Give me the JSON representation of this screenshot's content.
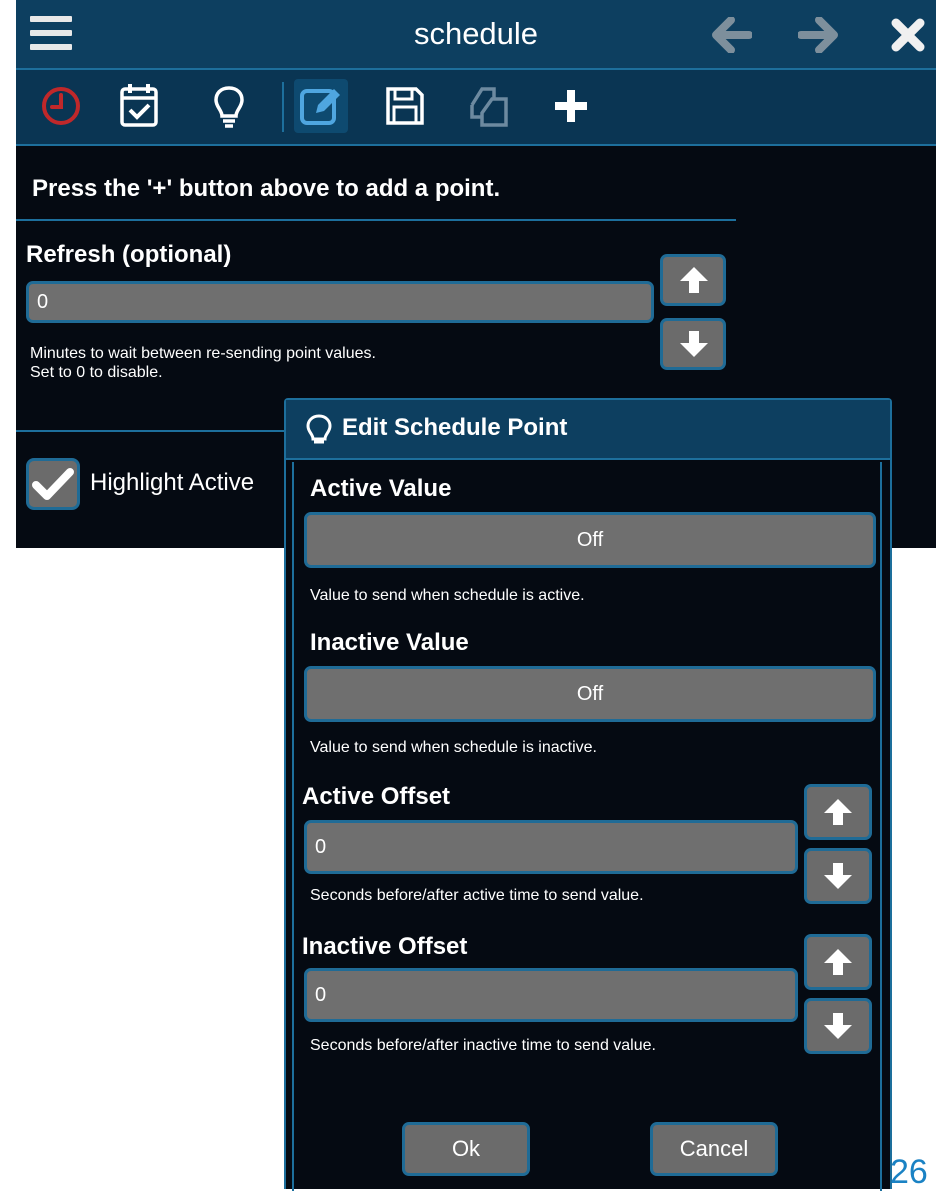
{
  "window": {
    "title": "schedule"
  },
  "toolbar": {
    "tools": [
      {
        "icon": "clock-icon",
        "color": "#c0282a"
      },
      {
        "icon": "calendar-check-icon",
        "color": "#ffffff"
      },
      {
        "icon": "lightbulb-icon",
        "color": "#ffffff"
      },
      {
        "icon": "edit-icon",
        "color": "#4fa6e0",
        "selected": true
      },
      {
        "icon": "save-icon",
        "color": "#ffffff"
      },
      {
        "icon": "copy-icon",
        "color": "#6d8aa0",
        "disabled": true
      },
      {
        "icon": "plus-icon",
        "color": "#ffffff"
      }
    ]
  },
  "main": {
    "hint": "Press the '+' button above to add a point.",
    "refresh": {
      "label": "Refresh (optional)",
      "value": "0",
      "help_line1": "Minutes to wait between re-sending point values.",
      "help_line2": "Set to 0 to disable."
    },
    "highlight": {
      "label": "Highlight Active",
      "checked": true
    }
  },
  "dialog": {
    "title": "Edit Schedule Point",
    "active_value": {
      "label": "Active Value",
      "value": "Off",
      "help": "Value to send when schedule is active."
    },
    "inactive_value": {
      "label": "Inactive Value",
      "value": "Off",
      "help": "Value to send when schedule is inactive."
    },
    "active_offset": {
      "label": "Active Offset",
      "value": "0",
      "help": "Seconds before/after active time to send value."
    },
    "inactive_offset": {
      "label": "Inactive Offset",
      "value": "0",
      "help": "Seconds before/after inactive time to send value."
    },
    "ok_label": "Ok",
    "cancel_label": "Cancel"
  },
  "page_number": "26",
  "colors": {
    "accent": "#1d6f9c",
    "header": "#0d3f60",
    "background": "#050a12",
    "field": "#6f6f6f",
    "page_number": "#1a82c4"
  }
}
